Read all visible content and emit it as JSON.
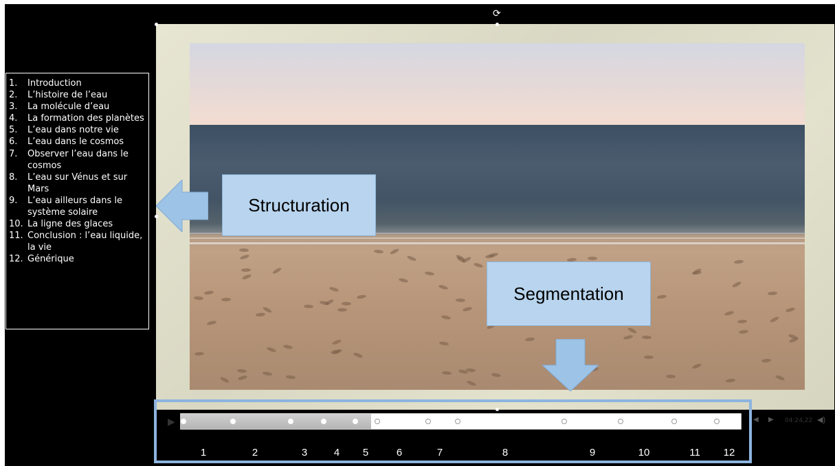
{
  "chapters": [
    {
      "num": "1.",
      "text": "Introduction"
    },
    {
      "num": "2.",
      "text": "L’histoire de l’eau"
    },
    {
      "num": "3.",
      "text": "La molécule d’eau"
    },
    {
      "num": "4.",
      "text": "La formation des planètes"
    },
    {
      "num": "5.",
      "text": "L’eau dans notre vie"
    },
    {
      "num": "6.",
      "text": "L’eau dans le cosmos"
    },
    {
      "num": "7.",
      "text": "Observer l’eau dans le cosmos"
    },
    {
      "num": "8.",
      "text": "L’eau sur Vénus et sur Mars"
    },
    {
      "num": "9.",
      "text": "L’eau ailleurs dans le système solaire"
    },
    {
      "num": "10.",
      "text": "La ligne des glaces"
    },
    {
      "num": "11.",
      "text": "Conclusion : l’eau liquide, la vie"
    },
    {
      "num": "12.",
      "text": "Générique"
    }
  ],
  "labels": {
    "structuration": "Structuration",
    "segmentation": "Segmentation"
  },
  "player": {
    "time": "04:24,22",
    "progress": 0.34,
    "play_icon": "play-icon",
    "volume_icon": "volume-icon"
  },
  "segment_numbers": [
    "1",
    "2",
    "3",
    "4",
    "5",
    "6",
    "7",
    "8",
    "9",
    "10",
    "11",
    "12"
  ],
  "colors": {
    "label_fill": "#b8d4ee",
    "arrow_fill": "#9dc3e6",
    "box_border": "#8db4df"
  }
}
